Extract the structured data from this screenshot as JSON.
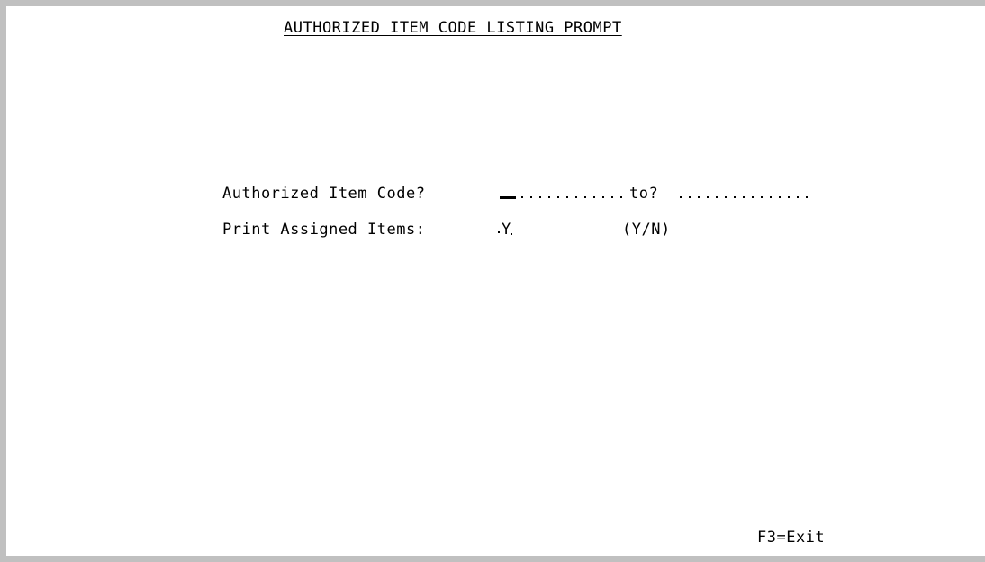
{
  "screen": {
    "title": "AUTHORIZED ITEM CODE LISTING PROMPT"
  },
  "fields": {
    "item_code": {
      "label": "Authorized Item Code?",
      "from_value": "",
      "to_label": "to?",
      "to_value": ""
    },
    "print_assigned": {
      "label": "Print Assigned Items:",
      "value": "Y",
      "hint": "(Y/N)"
    }
  },
  "function_keys": {
    "f3": "F3=Exit"
  }
}
